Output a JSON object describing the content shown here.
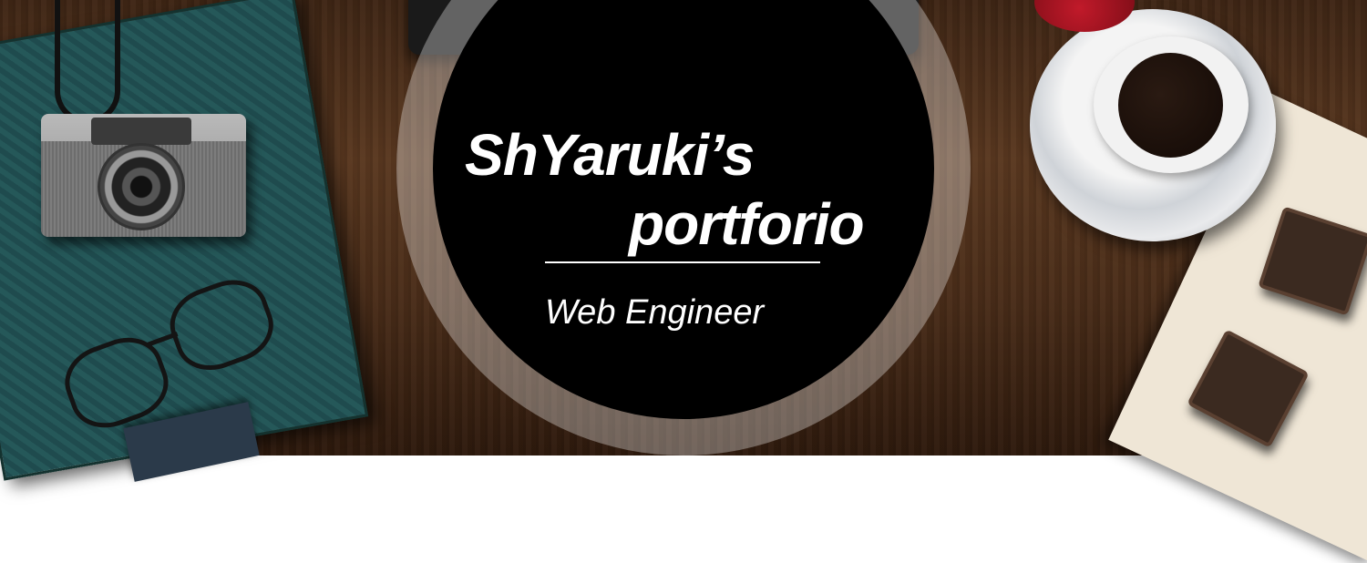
{
  "banner": {
    "title_line1": "ShYaruki’s",
    "title_line2": "portforio",
    "subtitle": "Web Engineer"
  },
  "background": {
    "description_items": [
      "camera-icon",
      "notebook-icon",
      "glasses-icon",
      "coffee-cup-icon",
      "rose-icon",
      "letterpress-stamp-icon"
    ]
  },
  "colors": {
    "disc": "#000000",
    "halo": "rgba(255,255,255,0.32)",
    "text": "#ffffff",
    "wood": "#5a3820"
  }
}
